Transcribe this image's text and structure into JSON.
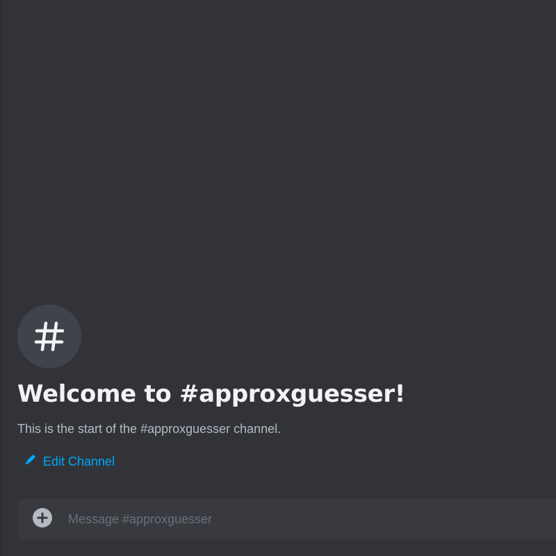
{
  "channel": {
    "icon": "hash-icon",
    "name": "approxguesser"
  },
  "welcome": {
    "title": "Welcome to #approxguesser!",
    "subtitle": "This is the start of the #approxguesser channel."
  },
  "actions": {
    "edit_channel_label": "Edit Channel",
    "edit_channel_icon": "pencil-icon"
  },
  "composer": {
    "placeholder": "Message #approxguesser",
    "value": "",
    "attach_icon": "plus-circle-icon"
  },
  "colors": {
    "background": "#313338",
    "avatar_bg": "#41434a",
    "title": "#f2f3f5",
    "subtitle": "#b5bac1",
    "link": "#00a8fc",
    "composer_bg": "#383a40",
    "placeholder": "#6d6f78"
  }
}
